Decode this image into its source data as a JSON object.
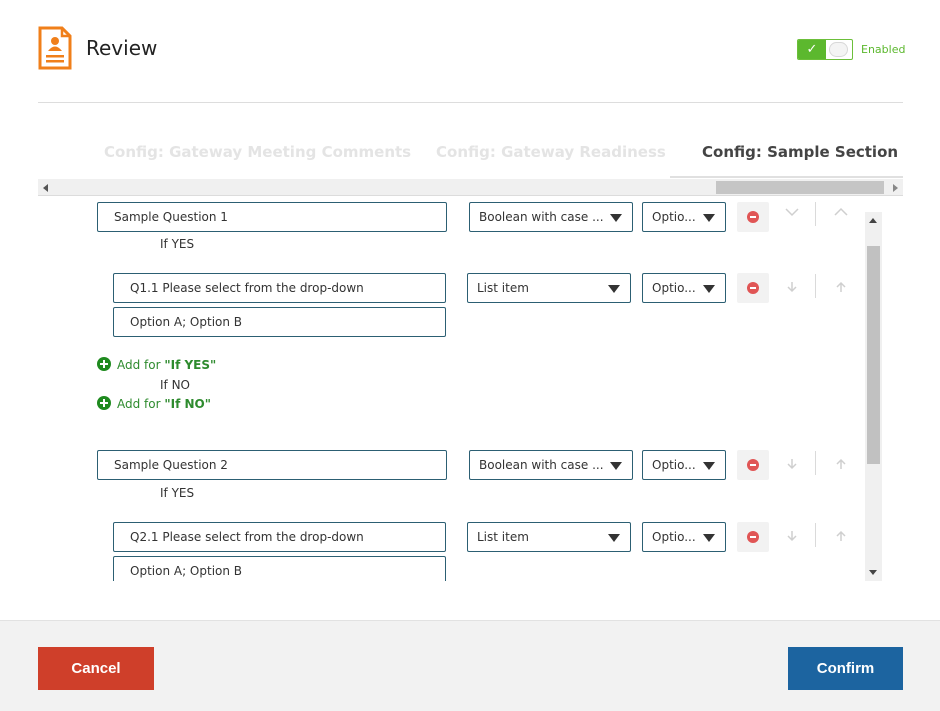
{
  "header": {
    "title": "Review",
    "icon": "profile-document-icon",
    "toggle": {
      "check": "✓",
      "state_label": "Enabled",
      "accent": "#5cb82e"
    }
  },
  "tabs": [
    {
      "label": "Config: Gateway Meeting Comments",
      "active": false
    },
    {
      "label": "Config: Gateway Readiness",
      "active": false
    },
    {
      "label": "Config: Sample Section",
      "active": true
    }
  ],
  "questions": [
    {
      "text": "Sample Question 1",
      "type": "Boolean with case ...",
      "required": "Optio...",
      "if_yes_label": "If YES",
      "sub_question": {
        "text": "Q1.1 Please select from the drop-down",
        "type": "List item",
        "required": "Optio...",
        "options": "Option A; Option B"
      },
      "add_yes": {
        "prefix": "Add for ",
        "quote": "\"If YES\""
      },
      "if_no_label": "If NO",
      "add_no": {
        "prefix": "Add for ",
        "quote": "\"If NO\""
      }
    },
    {
      "text": "Sample Question 2",
      "type": "Boolean with case ...",
      "required": "Optio...",
      "if_yes_label": "If YES",
      "sub_question": {
        "text": "Q2.1 Please select from the drop-down",
        "type": "List item",
        "required": "Optio...",
        "options": "Option A; Option B"
      }
    }
  ],
  "footer": {
    "cancel_label": "Cancel",
    "confirm_label": "Confirm",
    "cancel_color": "#cf3f2a",
    "confirm_color": "#1c64a0"
  }
}
